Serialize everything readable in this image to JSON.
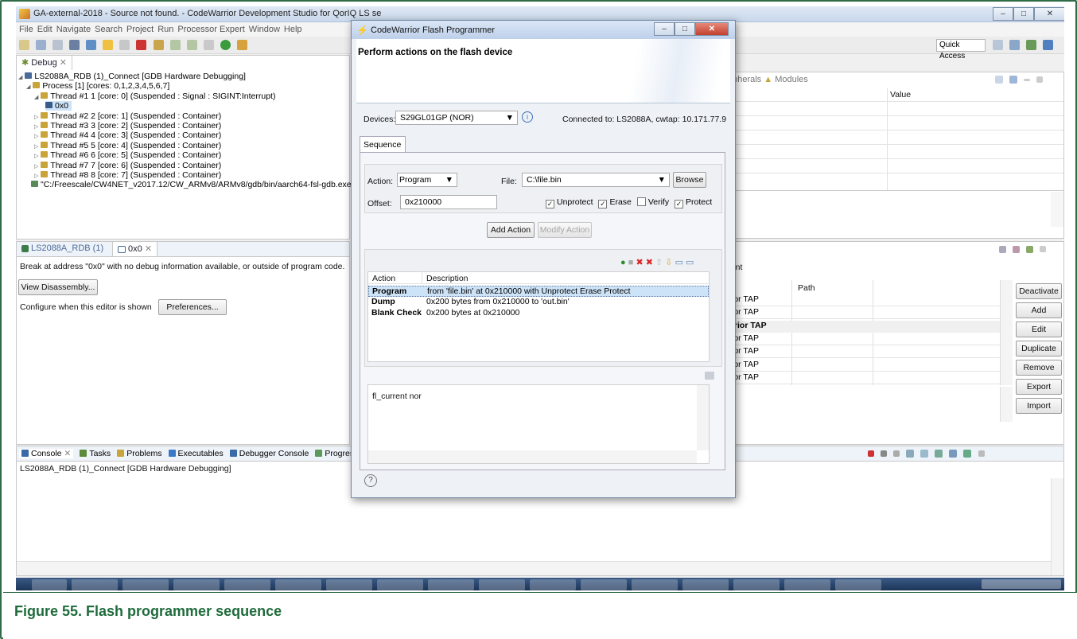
{
  "window": {
    "title": "GA-external-2018 - Source not found. - CodeWarrior Development Studio for QorIQ LS se"
  },
  "menu": [
    "File",
    "Edit",
    "Navigate",
    "Search",
    "Project",
    "Run",
    "Processor Expert",
    "Window",
    "Help"
  ],
  "quick_access": "Quick Access",
  "debug": {
    "tab": "Debug",
    "tree": [
      "LS2088A_RDB (1)_Connect [GDB Hardware Debugging]",
      "Process [1] [cores: 0,1,2,3,4,5,6,7]",
      "Thread #1 1 [core: 0] (Suspended : Signal : SIGINT:Interrupt)",
      "0x0",
      "Thread #2 2 [core: 1] (Suspended : Container)",
      "Thread #3 3 [core: 2] (Suspended : Container)",
      "Thread #4 4 [core: 3] (Suspended : Container)",
      "Thread #5 5 [core: 4] (Suspended : Container)",
      "Thread #6 6 [core: 5] (Suspended : Container)",
      "Thread #7 7 [core: 6] (Suspended : Container)",
      "Thread #8 8 [core: 7] (Suspended : Container)",
      "\"C:/Freescale/CW4NET_v2017.12/CW_ARMv8/ARMv8/gdb/bin/aarch64-fsl-gdb.exe"
    ]
  },
  "editor": {
    "tab1": "LS2088A_RDB (1)",
    "tab2": "0x0",
    "message": "Break at address \"0x0\" with no debug information available, or outside of program code.",
    "view_disassembly": "View Disassembly...",
    "configure_text": "Configure when this editor is shown",
    "preferences": "Preferences..."
  },
  "right_pane": {
    "tab_peripherals": "ripherals",
    "tab_modules": "Modules",
    "col_name": "e",
    "col_value": "Value",
    "lower_heading": "nent",
    "col_path": "Path",
    "items": [
      "rrior TAP",
      "rrior TAP",
      "arrior TAP",
      "rrior TAP",
      "rrior TAP",
      "rrior TAP",
      "rrior TAP"
    ],
    "buttons": [
      "Deactivate",
      "Add",
      "Edit",
      "Duplicate",
      "Remove",
      "Export",
      "Import"
    ]
  },
  "console": {
    "tabs": [
      "Console",
      "Tasks",
      "Problems",
      "Executables",
      "Debugger Console",
      "Progress"
    ],
    "line": "LS2088A_RDB (1)_Connect [GDB Hardware Debugging]"
  },
  "dialog": {
    "title": "CodeWarrior Flash Programmer",
    "heading": "Perform actions on the flash device",
    "devices_label": "Devices:",
    "device_value": "S29GL01GP (NOR)",
    "connected": "Connected to: LS2088A, cwtap: 10.171.77.9",
    "sequence_tab": "Sequence",
    "action_label": "Action:",
    "action_value": "Program",
    "file_label": "File:",
    "file_value": "C:\\file.bin",
    "browse": "Browse",
    "offset_label": "Offset:",
    "offset_value": "0x210000",
    "cb_unprotect": "Unprotect",
    "cb_erase": "Erase",
    "cb_verify": "Verify",
    "cb_protect": "Protect",
    "add_action": "Add Action",
    "modify_action": "Modify Action",
    "table_headers": [
      "Action",
      "Description"
    ],
    "table_rows": [
      {
        "action": "Program",
        "description": "from 'file.bin' at 0x210000 with Unprotect Erase Protect"
      },
      {
        "action": "Dump",
        "description": "0x200 bytes from 0x210000 to 'out.bin'"
      },
      {
        "action": "Blank Check",
        "description": "0x200 bytes at 0x210000"
      }
    ],
    "log_text": "fl_current nor",
    "help": "?"
  },
  "caption": "Figure 55. Flash programmer sequence",
  "colors": {
    "caption": "#1e6b3b",
    "frame": "#2f6b47",
    "selection": "#cde3f7"
  }
}
